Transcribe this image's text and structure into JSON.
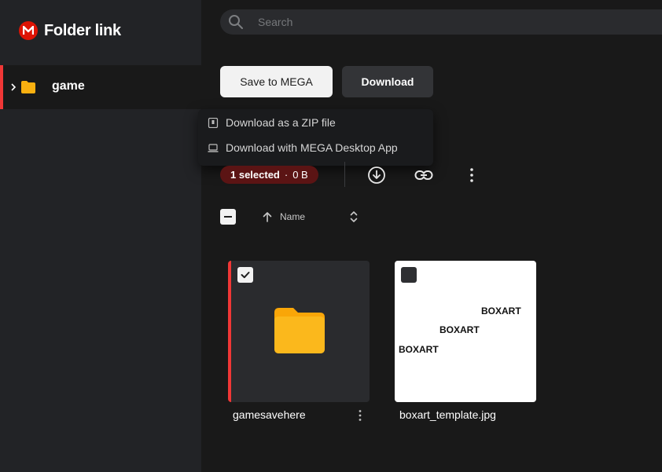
{
  "brand": {
    "title": "Folder link",
    "logo_icon": "mega-logo-icon"
  },
  "sidebar": {
    "items": [
      {
        "label": "game",
        "icon": "folder-icon",
        "expanded": false
      }
    ]
  },
  "search": {
    "placeholder": "Search"
  },
  "actions": {
    "save_label": "Save to MEGA",
    "download_label": "Download"
  },
  "download_menu": {
    "items": [
      {
        "label": "Download as a ZIP file",
        "icon": "zip-icon"
      },
      {
        "label": "Download with MEGA Desktop App",
        "icon": "laptop-icon"
      }
    ]
  },
  "selection": {
    "count_text": "1 selected",
    "separator": "·",
    "size_text": "0 B"
  },
  "sort": {
    "label": "Name"
  },
  "files": [
    {
      "name": "gamesavehere",
      "type": "folder",
      "selected": true
    },
    {
      "name": "boxart_template.jpg",
      "type": "image",
      "selected": false,
      "thumb_text": [
        "BOXART",
        "BOXART",
        "BOXART"
      ]
    }
  ],
  "colors": {
    "accent": "#f03736",
    "folder": "#f9b010",
    "brand_red": "#dd1405",
    "pill": "#5b1414"
  }
}
